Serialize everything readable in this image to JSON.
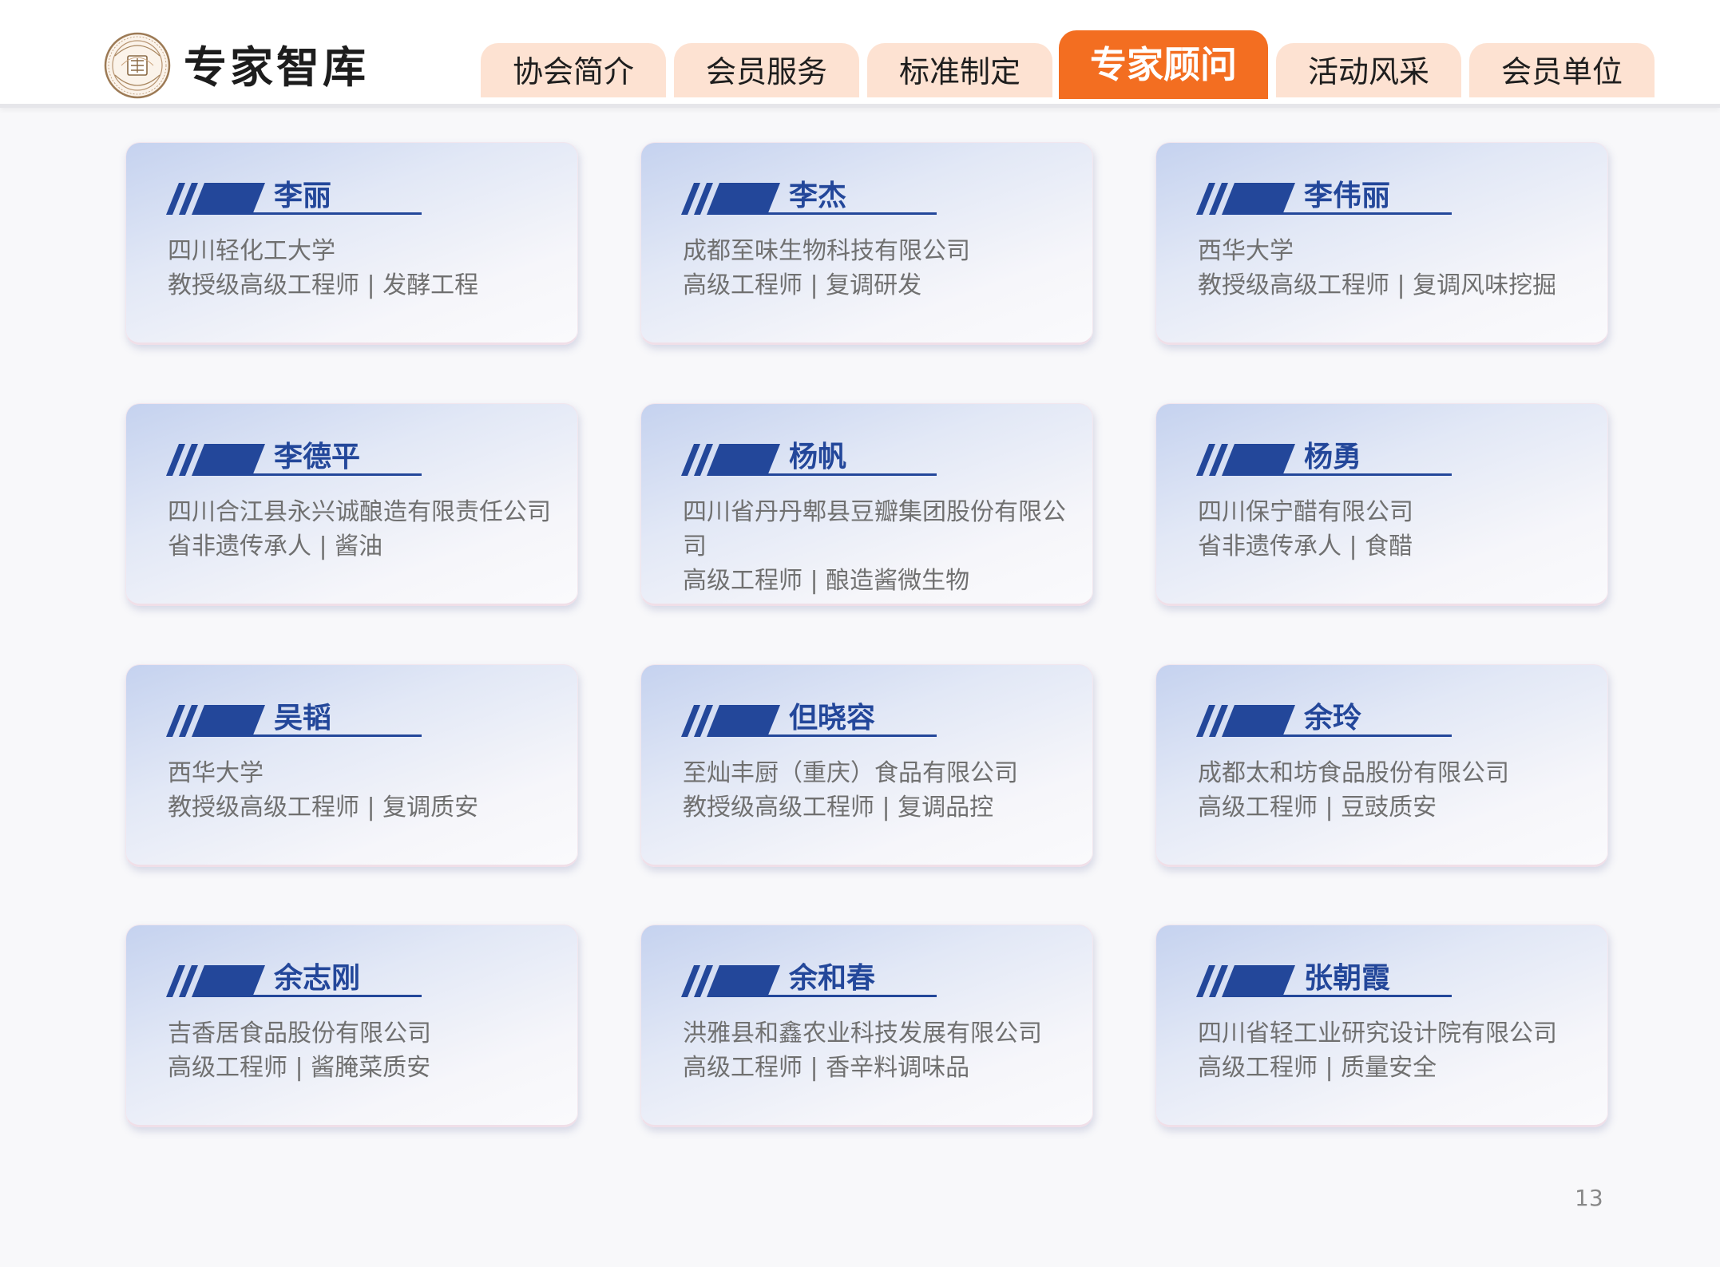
{
  "header": {
    "title": "专家智库",
    "logo_icon": "association-seal-logo"
  },
  "nav": {
    "tabs": [
      {
        "label": "协会简介",
        "active": false
      },
      {
        "label": "会员服务",
        "active": false
      },
      {
        "label": "标准制定",
        "active": false
      },
      {
        "label": "专家顾问",
        "active": true
      },
      {
        "label": "活动风采",
        "active": false
      },
      {
        "label": "会员单位",
        "active": false
      }
    ]
  },
  "experts": [
    {
      "name": "李丽",
      "org": "四川轻化工大学",
      "title": "教授级高级工程师 | 发酵工程"
    },
    {
      "name": "李杰",
      "org": "成都至味生物科技有限公司",
      "title": "高级工程师 | 复调研发"
    },
    {
      "name": "李伟丽",
      "org": "西华大学",
      "title": "教授级高级工程师 | 复调风味挖掘"
    },
    {
      "name": "李德平",
      "org": "四川合江县永兴诚酿造有限责任公司",
      "title": "省非遗传承人 | 酱油"
    },
    {
      "name": "杨帆",
      "org": "四川省丹丹郫县豆瓣集团股份有限公司",
      "title": "高级工程师 | 酿造酱微生物"
    },
    {
      "name": "杨勇",
      "org": "四川保宁醋有限公司",
      "title": "省非遗传承人 | 食醋"
    },
    {
      "name": "吴韬",
      "org": "西华大学",
      "title": "教授级高级工程师 | 复调质安"
    },
    {
      "name": "但晓容",
      "org": "至灿丰厨（重庆）食品有限公司",
      "title": "教授级高级工程师 | 复调品控"
    },
    {
      "name": "余玲",
      "org": "成都太和坊食品股份有限公司",
      "title": "高级工程师 | 豆豉质安"
    },
    {
      "name": "余志刚",
      "org": "吉香居食品股份有限公司",
      "title": "高级工程师 | 酱腌菜质安"
    },
    {
      "name": "余和春",
      "org": "洪雅县和鑫农业科技发展有限公司",
      "title": "高级工程师 | 香辛料调味品"
    },
    {
      "name": "张朝霞",
      "org": "四川省轻工业研究设计院有限公司",
      "title": "高级工程师 | 质量安全"
    }
  ],
  "footer": {
    "page_number": "13"
  },
  "colors": {
    "accent_orange": "#f36e21",
    "tab_bg": "#fde2d2",
    "name_blue": "#23479a",
    "text_gray": "#707070"
  }
}
